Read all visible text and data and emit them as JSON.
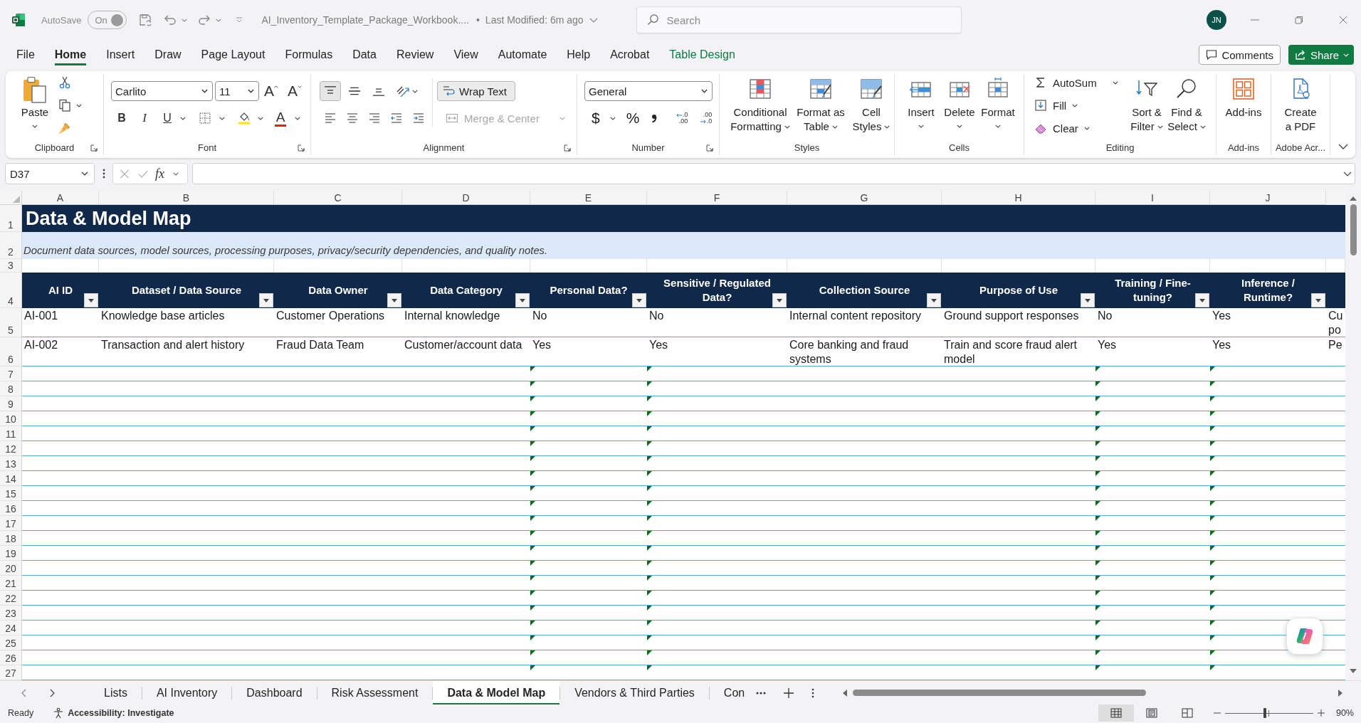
{
  "title_bar": {
    "autosave_label": "AutoSave",
    "autosave_toggle": {
      "label": "On",
      "on": true
    },
    "document_name": "AI_Inventory_Template_Package_Workbook....",
    "separator": "•",
    "last_modified": "Last Modified: 6m ago",
    "search": {
      "placeholder": "Search"
    },
    "avatar": "JN"
  },
  "ribbon_tabs": [
    {
      "label": "File",
      "selected": false,
      "kind": "standard"
    },
    {
      "label": "Home",
      "selected": true,
      "kind": "standard"
    },
    {
      "label": "Insert",
      "selected": false,
      "kind": "standard"
    },
    {
      "label": "Draw",
      "selected": false,
      "kind": "standard"
    },
    {
      "label": "Page Layout",
      "selected": false,
      "kind": "standard"
    },
    {
      "label": "Formulas",
      "selected": false,
      "kind": "standard"
    },
    {
      "label": "Data",
      "selected": false,
      "kind": "standard"
    },
    {
      "label": "Review",
      "selected": false,
      "kind": "standard"
    },
    {
      "label": "View",
      "selected": false,
      "kind": "standard"
    },
    {
      "label": "Automate",
      "selected": false,
      "kind": "standard"
    },
    {
      "label": "Help",
      "selected": false,
      "kind": "standard"
    },
    {
      "label": "Acrobat",
      "selected": false,
      "kind": "standard"
    },
    {
      "label": "Table Design",
      "selected": false,
      "kind": "contextual"
    }
  ],
  "ribbon_actions": {
    "comments": "Comments",
    "share": "Share"
  },
  "ribbon": {
    "clipboard": {
      "title": "Clipboard",
      "paste": "Paste"
    },
    "font": {
      "title": "Font",
      "font_name": "Carlito",
      "font_size": "11",
      "grow_font": "A",
      "shrink_font": "A",
      "bold": "B",
      "italic": "I",
      "underline": "U",
      "font_color": "A"
    },
    "alignment": {
      "title": "Alignment",
      "vertical_align": [
        {
          "selected": true
        },
        {
          "selected": false
        },
        {
          "selected": false
        }
      ],
      "wrap_text": {
        "label": "Wrap Text",
        "selected": true
      },
      "merge_center": {
        "label": "Merge & Center",
        "disabled": true
      }
    },
    "number": {
      "title": "Number",
      "format": "General",
      "currency": "$",
      "percent": "%",
      "increase_decimal": [
        ".0",
        ".00"
      ],
      "decrease_decimal": [
        ".00",
        ".0"
      ]
    },
    "styles": {
      "title": "Styles",
      "buttons": [
        {
          "lines": [
            "Conditional",
            "Formatting"
          ]
        },
        {
          "lines": [
            "Format as",
            "Table"
          ]
        },
        {
          "lines": [
            "Cell",
            "Styles"
          ]
        }
      ]
    },
    "cells": {
      "title": "Cells",
      "buttons": [
        "Insert",
        "Delete",
        "Format"
      ]
    },
    "editing": {
      "title": "Editing",
      "small_buttons": [
        "AutoSum",
        "Fill",
        "Clear"
      ],
      "large_buttons": [
        {
          "lines": [
            "Sort &",
            "Filter"
          ]
        },
        {
          "lines": [
            "Find &",
            "Select"
          ]
        }
      ]
    },
    "add_ins": {
      "title": "Add-ins",
      "button": "Add-ins"
    },
    "adobe": {
      "title": "Adobe Acr...",
      "button": [
        "Create",
        "a PDF"
      ]
    }
  },
  "formula_bar": {
    "name_box": "D37",
    "function_button": "fx"
  },
  "sheet": {
    "column_letters": [
      "A",
      "B",
      "C",
      "D",
      "E",
      "F",
      "G",
      "H",
      "I",
      "J"
    ],
    "title_row": {
      "number": "1",
      "text": "Data & Model Map"
    },
    "subtitle_row": {
      "number": "2",
      "text": "Document data sources, model sources, processing purposes, privacy/security dependencies, and quality notes."
    },
    "spacer_row": {
      "number": "3"
    },
    "header_row": {
      "number": "4",
      "columns": [
        {
          "heading": "AI ID",
          "error_flag": false
        },
        {
          "heading": "Dataset / Data Source",
          "error_flag": false
        },
        {
          "heading": "Data Owner",
          "error_flag": false
        },
        {
          "heading": "Data Category",
          "error_flag": false
        },
        {
          "heading": "Personal Data?",
          "error_flag": true
        },
        {
          "heading": "Sensitive / Regulated Data?",
          "error_flag": true
        },
        {
          "heading": "Collection Source",
          "error_flag": false
        },
        {
          "heading": "Purpose of Use",
          "error_flag": false
        },
        {
          "heading": "Training / Fine-tuning?",
          "error_flag": true
        },
        {
          "heading": "Inference / Runtime?",
          "error_flag": true
        }
      ]
    },
    "data_rows": [
      {
        "number": "5",
        "cells": [
          "AI-001",
          "Knowledge base articles",
          "Customer Operations",
          "Internal knowledge",
          "No",
          "No",
          "Internal content repository",
          "Ground support responses",
          "No",
          "Yes",
          "Cu po"
        ]
      },
      {
        "number": "6",
        "cells": [
          "AI-002",
          "Transaction and alert history",
          "Fraud Data Team",
          "Customer/account data",
          "Yes",
          "Yes",
          "Core banking and fraud systems",
          "Train and score fraud alert model",
          "Yes",
          "Yes",
          "Pe"
        ]
      }
    ],
    "empty_rows": [
      "7",
      "8",
      "9",
      "10",
      "11",
      "12",
      "13",
      "14",
      "15",
      "16",
      "17",
      "18",
      "19",
      "20",
      "21",
      "22",
      "23",
      "24",
      "25",
      "26",
      "27"
    ]
  },
  "sheet_tabs": [
    {
      "label": "Lists",
      "selected": false
    },
    {
      "label": "AI Inventory",
      "selected": false
    },
    {
      "label": "Dashboard",
      "selected": false
    },
    {
      "label": "Risk Assessment",
      "selected": false
    },
    {
      "label": "Data & Model Map",
      "selected": true
    },
    {
      "label": "Vendors & Third Parties",
      "selected": false
    },
    {
      "label": "Con",
      "selected": false
    }
  ],
  "status_bar": {
    "ready": "Ready",
    "accessibility": "Accessibility: Investigate",
    "views": [
      {
        "selected": true
      },
      {
        "selected": false
      },
      {
        "selected": false
      }
    ],
    "zoom": {
      "level": 0.45,
      "reading": "90%"
    }
  }
}
